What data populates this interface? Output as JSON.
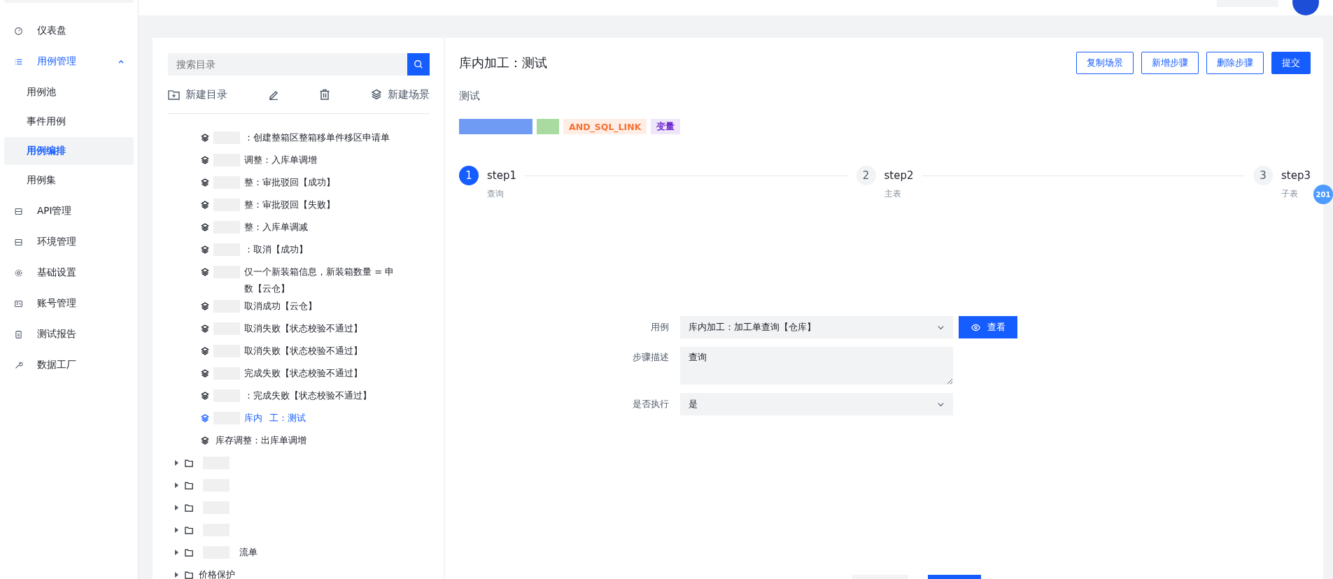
{
  "sidebar": {
    "items": [
      {
        "label": "仪表盘",
        "selected": false
      },
      {
        "label": "用例管理",
        "expanded": true,
        "children": [
          {
            "label": "用例池",
            "selected": false
          },
          {
            "label": "事件用例",
            "selected": false
          },
          {
            "label": "用例编排",
            "selected": true
          },
          {
            "label": "用例集",
            "selected": false
          }
        ]
      },
      {
        "label": "API管理",
        "selected": false
      },
      {
        "label": "环境管理",
        "selected": false
      },
      {
        "label": "基础设置",
        "selected": false
      },
      {
        "label": "账号管理",
        "selected": false
      },
      {
        "label": "测试报告",
        "selected": false
      },
      {
        "label": "数据工厂",
        "selected": false
      }
    ]
  },
  "tree": {
    "search": {
      "placeholder": "搜索目录"
    },
    "toolbar": {
      "new_folder": "新建目录",
      "new_scene": "新建场景"
    },
    "scenes": [
      {
        "lines": [
          "：创建整箱区整箱移单件移区申请单"
        ],
        "redacted": true,
        "selected": false
      },
      {
        "lines": [
          "调整：入库单调增"
        ],
        "redacted": true,
        "selected": false
      },
      {
        "lines": [
          "整：审批驳回【成功】"
        ],
        "redacted": true,
        "selected": false
      },
      {
        "lines": [
          "整：审批驳回【失败】"
        ],
        "redacted": true,
        "selected": false
      },
      {
        "lines": [
          "整：入库单调减"
        ],
        "redacted": true,
        "selected": false
      },
      {
        "lines": [
          "：取消【成功】"
        ],
        "redacted": true,
        "selected": false
      },
      {
        "lines": [
          "仅一个新装箱信息，新装箱数量 = 申",
          "数【云仓】"
        ],
        "redacted": true,
        "selected": false
      },
      {
        "lines": [
          "取消成功【云仓】"
        ],
        "redacted": true,
        "selected": false
      },
      {
        "lines": [
          "取消失败【状态校验不通过】"
        ],
        "redacted": true,
        "selected": false
      },
      {
        "lines": [
          "取消失败【状态校验不通过】"
        ],
        "redacted": true,
        "selected": false
      },
      {
        "lines": [
          "完成失败【状态校验不通过】"
        ],
        "redacted": true,
        "selected": false
      },
      {
        "lines": [
          "：完成失败【状态校验不通过】"
        ],
        "redacted": true,
        "selected": false
      },
      {
        "lines": [
          "库内",
          "工：测试"
        ],
        "redacted": true,
        "selected": true
      },
      {
        "lines": [
          "库存调整：出库单调增"
        ],
        "redacted": false,
        "selected": false
      }
    ],
    "folders": [
      {
        "expanded": false,
        "redacted": true
      },
      {
        "expanded": false,
        "redacted": true
      },
      {
        "expanded": false,
        "redacted": true
      },
      {
        "expanded": false,
        "redacted": true
      },
      {
        "name": "流单",
        "expanded": false,
        "redacted": true
      },
      {
        "name": "价格保护",
        "expanded": false,
        "redacted": false
      }
    ]
  },
  "scene": {
    "title": "库内加工：测试",
    "buttons": [
      {
        "label": "复制场景",
        "kind": "outline"
      },
      {
        "label": "新增步骤",
        "kind": "outline"
      },
      {
        "label": "删除步骤",
        "kind": "outline"
      },
      {
        "label": "提交",
        "kind": "primary"
      }
    ],
    "description": "测试",
    "tags": [
      {
        "color": "#6f9bf5"
      },
      {
        "color": "#a9dba0"
      },
      {
        "label": "AND_SQL_LINK",
        "color": "#f77234"
      },
      {
        "label": "变量",
        "color": "#722ed1"
      }
    ],
    "steps": [
      {
        "number": "1",
        "title": "step1",
        "subtitle": "查询",
        "active": true
      },
      {
        "number": "2",
        "title": "step2",
        "subtitle": "主表",
        "active": false
      },
      {
        "number": "3",
        "title": "step3",
        "subtitle": "子表",
        "active": false
      }
    ],
    "form": {
      "case_label": "用例",
      "case_value": "库内加工：加工单查询【仓库】",
      "view_button": "查看",
      "desc_label": "步骤描述",
      "desc_value": "查询",
      "exec_label": "是否执行",
      "exec_value": "是"
    }
  },
  "float_badge": "201"
}
